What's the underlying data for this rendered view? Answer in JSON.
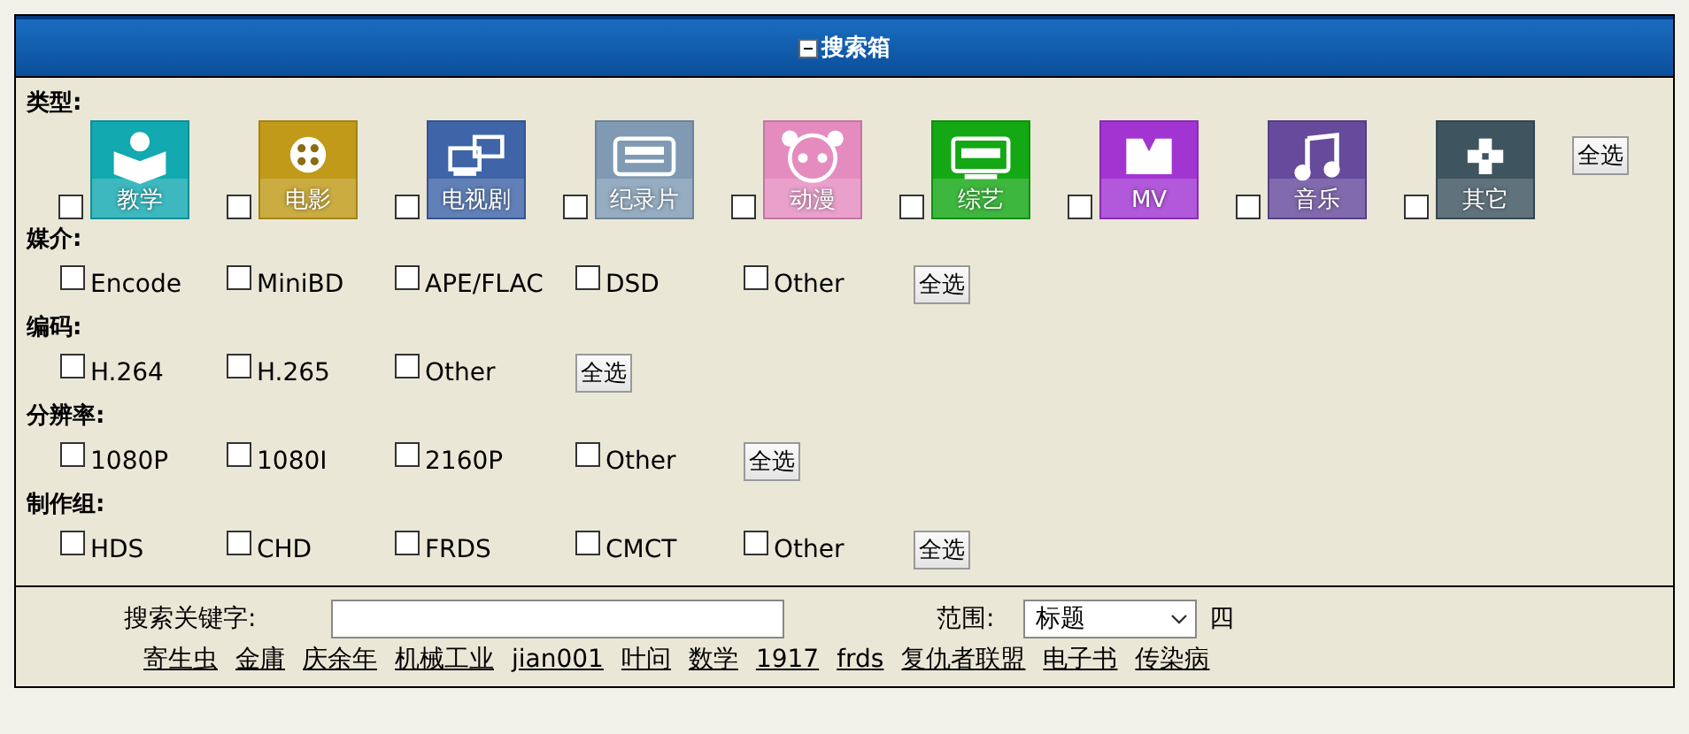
{
  "header": {
    "title": "搜索箱"
  },
  "categories": {
    "label": "类型:",
    "items": [
      {
        "label": "教学",
        "checked": false,
        "color": "#12a9b0"
      },
      {
        "label": "电影",
        "checked": false,
        "color": "#c09a18"
      },
      {
        "label": "电视剧",
        "checked": false,
        "color": "#3f64a8"
      },
      {
        "label": "纪录片",
        "checked": false,
        "color": "#7f9ab2"
      },
      {
        "label": "动漫",
        "checked": false,
        "color": "#e48cc0"
      },
      {
        "label": "综艺",
        "checked": false,
        "color": "#14a814"
      },
      {
        "label": "MV",
        "checked": false,
        "color": "#a234d2"
      },
      {
        "label": "音乐",
        "checked": false,
        "color": "#664a9c"
      },
      {
        "label": "其它",
        "checked": false,
        "color": "#3e545e"
      }
    ],
    "select_all": "全选"
  },
  "groups": [
    {
      "label": "媒介:",
      "options": [
        {
          "label": "Encode",
          "checked": false
        },
        {
          "label": "MiniBD",
          "checked": false
        },
        {
          "label": "APE/FLAC",
          "checked": false
        },
        {
          "label": "DSD",
          "checked": false
        },
        {
          "label": "Other",
          "checked": false
        }
      ],
      "select_all": "全选"
    },
    {
      "label": "编码:",
      "options": [
        {
          "label": "H.264",
          "checked": false
        },
        {
          "label": "H.265",
          "checked": false
        },
        {
          "label": "Other",
          "checked": false
        }
      ],
      "select_all": "全选"
    },
    {
      "label": "分辨率:",
      "options": [
        {
          "label": "1080P",
          "checked": false
        },
        {
          "label": "1080I",
          "checked": false
        },
        {
          "label": "2160P",
          "checked": false
        },
        {
          "label": "Other",
          "checked": false
        }
      ],
      "select_all": "全选"
    },
    {
      "label": "制作组:",
      "options": [
        {
          "label": "HDS",
          "checked": false
        },
        {
          "label": "CHD",
          "checked": false
        },
        {
          "label": "FRDS",
          "checked": false
        },
        {
          "label": "CMCT",
          "checked": false
        },
        {
          "label": "Other",
          "checked": false
        }
      ],
      "select_all": "全选"
    }
  ],
  "search": {
    "keyword_label": "搜索关键字:",
    "scope_label": "范围:",
    "scope_value": "标题",
    "extra_label": "四"
  },
  "hot_links": [
    "寄生虫",
    "金庸",
    "庆余年",
    "机械工业",
    "jian001",
    "叶问",
    "数学",
    "1917",
    "frds",
    "复仇者联盟",
    "电子书",
    "传染病"
  ]
}
